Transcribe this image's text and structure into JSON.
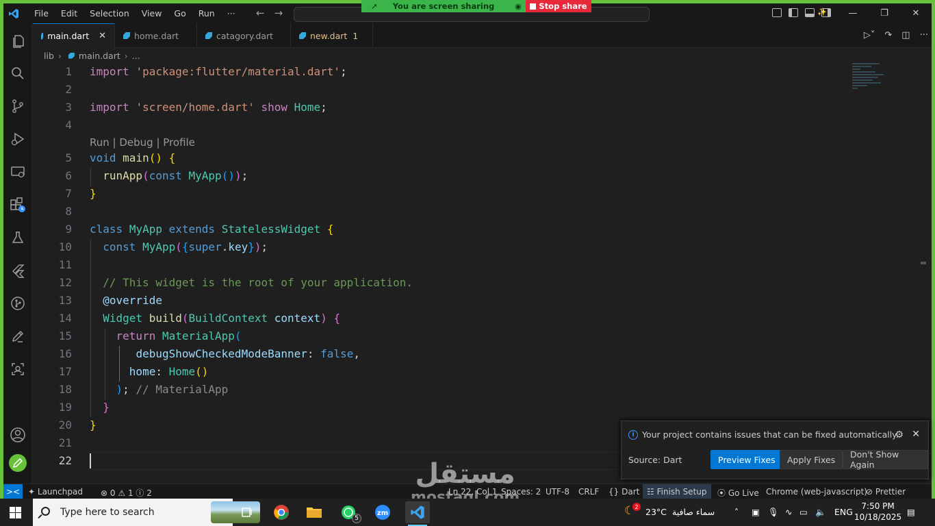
{
  "menu": [
    "File",
    "Edit",
    "Selection",
    "View",
    "Go",
    "Run",
    "···"
  ],
  "share": {
    "status": "You are screen sharing",
    "stop": "Stop share"
  },
  "tabs": [
    {
      "label": "main.dart",
      "active": true
    },
    {
      "label": "home.dart"
    },
    {
      "label": "catagory.dart"
    },
    {
      "label": "new.dart",
      "badge": "1"
    }
  ],
  "breadcrumb": {
    "folder": "lib",
    "file": "main.dart",
    "more": "..."
  },
  "codelens": "Run | Debug | Profile",
  "line_numbers": [
    "1",
    "2",
    "3",
    "4",
    "5",
    "6",
    "7",
    "8",
    "9",
    "10",
    "11",
    "12",
    "13",
    "14",
    "15",
    "16",
    "17",
    "18",
    "19",
    "20",
    "21",
    "22"
  ],
  "notification": {
    "message": "Your project contains issues that can be fixed automatically.",
    "source": "Source: Dart",
    "preview": "Preview Fixes",
    "apply": "Apply Fixes",
    "dismiss": "Don't Show Again"
  },
  "statusbar": {
    "launchpad": "Launchpad",
    "errors": "0",
    "warnings": "1",
    "infos": "2",
    "position": "Ln 22, Col 1",
    "spaces": "Spaces: 2",
    "encoding": "UTF-8",
    "eol": "CRLF",
    "language": "Dart",
    "finish_setup": "Finish Setup",
    "go_live": "Go Live",
    "device": "Chrome (web-javascript)",
    "prettier": "Prettier"
  },
  "taskbar": {
    "search_placeholder": "Type here to search",
    "weather_badge": "2",
    "temperature": "23°C",
    "weather_text": "سماء صافية",
    "language": "ENG",
    "time": "7:50 PM",
    "date": "10/18/2025",
    "whatsapp_badge": "5"
  },
  "watermark": {
    "arabic": "مستقل",
    "latin": "mostaql.com"
  },
  "colors": {
    "accent": "#0078d4",
    "share_green": "#3bb54a",
    "share_red": "#e8293a",
    "frame": "#67c23a"
  }
}
